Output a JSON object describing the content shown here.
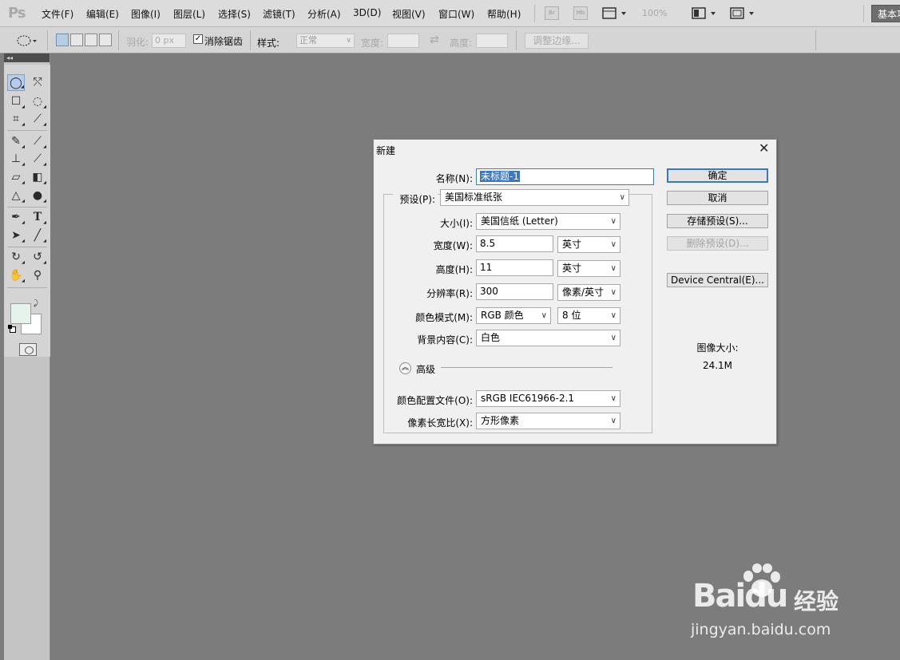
{
  "app": {
    "logo": "Ps"
  },
  "menu": {
    "items": [
      "文件(F)",
      "编辑(E)",
      "图像(I)",
      "图层(L)",
      "选择(S)",
      "滤镜(T)",
      "分析(A)",
      "3D(D)",
      "视图(V)",
      "窗口(W)",
      "帮助(H)"
    ],
    "bridge": "Br",
    "minibridge": "Mb",
    "zoom": "100%",
    "workspace": "基本功能"
  },
  "options": {
    "feather_label": "羽化:",
    "feather_value": "0 px",
    "antialias_label": "消除锯齿",
    "antialias_checked": true,
    "style_label": "样式:",
    "style_value": "正常",
    "width_label": "宽度:",
    "height_label": "高度:",
    "refine_edge": "调整边缘..."
  },
  "colors": {
    "foreground": "#e6f3ea",
    "background": "#ffffff",
    "accent": "#3a78c3"
  },
  "dialog": {
    "title": "新建",
    "name_label": "名称(N):",
    "name_value": "未标题-1",
    "preset_label": "预设(P):",
    "preset_value": "美国标准纸张",
    "size_label": "大小(I):",
    "size_value": "美国信纸 (Letter)",
    "width_label": "宽度(W):",
    "width_value": "8.5",
    "width_unit": "英寸",
    "height_label": "高度(H):",
    "height_value": "11",
    "height_unit": "英寸",
    "resolution_label": "分辨率(R):",
    "resolution_value": "300",
    "resolution_unit": "像素/英寸",
    "colormode_label": "颜色模式(M):",
    "colormode_value": "RGB 颜色",
    "bitdepth_value": "8 位",
    "bgcontent_label": "背景内容(C):",
    "bgcontent_value": "白色",
    "advanced_label": "高级",
    "profile_label": "颜色配置文件(O):",
    "profile_value": "sRGB IEC61966-2.1",
    "aspect_label": "像素长宽比(X):",
    "aspect_value": "方形像素",
    "ok": "确定",
    "cancel": "取消",
    "save_preset": "存储预设(S)...",
    "delete_preset": "删除预设(D)...",
    "device_central": "Device Central(E)...",
    "image_size_label": "图像大小:",
    "image_size_value": "24.1M"
  },
  "watermark": {
    "brand": "Baidu",
    "brand_suffix": "经验",
    "url": "jingyan.baidu.com"
  }
}
